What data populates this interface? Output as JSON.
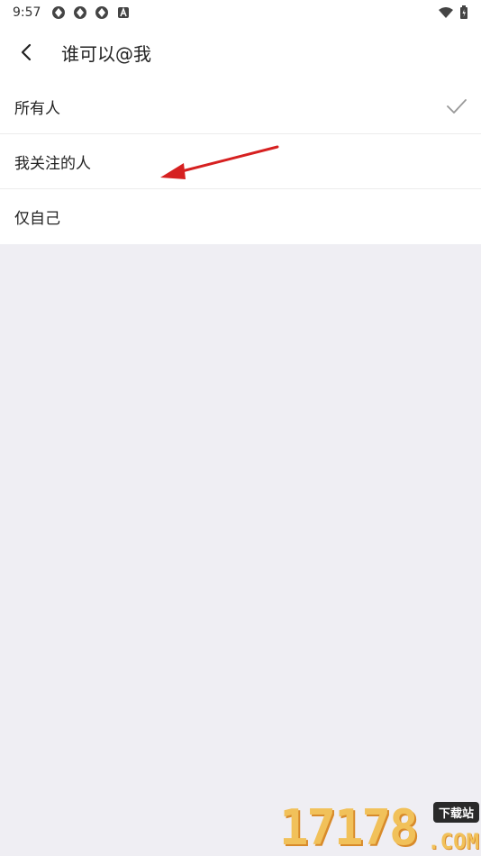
{
  "status_bar": {
    "time": "9:57",
    "icons": [
      "app-icon",
      "app-icon",
      "app-icon",
      "a-icon"
    ],
    "right_icons": [
      "wifi-icon",
      "battery-icon"
    ]
  },
  "header": {
    "back_icon": "back-arrow-icon",
    "title": "谁可以@我"
  },
  "options": [
    {
      "label": "所有人",
      "selected": true
    },
    {
      "label": "我关注的人",
      "selected": false
    },
    {
      "label": "仅自己",
      "selected": false
    }
  ],
  "colors": {
    "background": "#efeef3",
    "surface": "#ffffff",
    "check": "#999999",
    "annotation_arrow": "#d62020"
  },
  "watermark": {
    "digits": "17178",
    "badge": "下载站",
    "domain": ".COM"
  }
}
